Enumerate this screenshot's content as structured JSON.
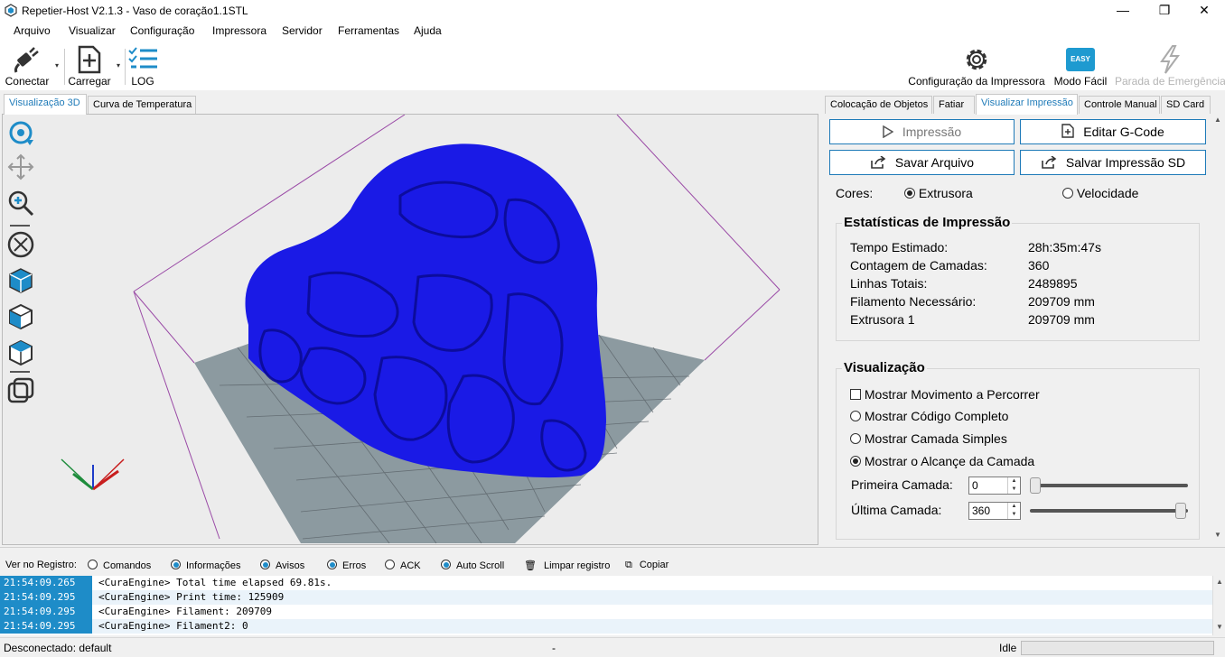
{
  "window": {
    "title": "Repetier-Host V2.1.3 - Vaso de coração1.1STL",
    "controls": {
      "minimize": "—",
      "maximize": "❐",
      "close": "✕"
    }
  },
  "menu": [
    "Arquivo",
    "Visualizar",
    "Configuração",
    "Impressora",
    "Servidor",
    "Ferramentas",
    "Ajuda"
  ],
  "toolbar": {
    "connect_label": "Conectar",
    "load_label": "Carregar",
    "log_label": "LOG",
    "printer_config_label": "Configuração da Impressora",
    "easy_mode_label": "Modo Fácil",
    "easy_badge": "EASY",
    "emergency_label": "Parada de Emergência"
  },
  "left_tabs": [
    "Visualização 3D",
    "Curva de Temperatura"
  ],
  "right_tabs": [
    "Colocação de Objetos",
    "Fatiar",
    "Visualizar Impressão",
    "Controle Manual",
    "SD Card"
  ],
  "preview": {
    "print_button": "Impressão",
    "edit_gcode_button": "Editar G-Code",
    "save_file_button": "Savar Arquivo",
    "save_sd_button": "Salvar Impressão SD",
    "colors_label": "Cores:",
    "color_extruder": "Extrusora",
    "color_speed": "Velocidade",
    "stats": {
      "title": "Estatísticas de Impressão",
      "rows": [
        {
          "label": "Tempo Estimado:",
          "value": "28h:35m:47s"
        },
        {
          "label": "Contagem de Camadas:",
          "value": "360"
        },
        {
          "label": "Linhas Totais:",
          "value": "2489895"
        },
        {
          "label": "Filamento Necessário:",
          "value": "209709 mm"
        },
        {
          "label": "Extrusora 1",
          "value": "209709 mm"
        }
      ]
    },
    "visual": {
      "title": "Visualização",
      "show_travel": "Mostrar Movimento a Percorrer",
      "show_complete": "Mostrar Código Completo",
      "show_single": "Mostrar Camada Simples",
      "show_range": "Mostrar o Alcançe da Camada",
      "first_layer_label": "Primeira Camada:",
      "first_layer_value": "0",
      "last_layer_label": "Última Camada:",
      "last_layer_value": "360",
      "first_slider_fraction": 0,
      "last_slider_fraction": 1
    }
  },
  "log": {
    "filter_label": "Ver no Registro:",
    "filters": [
      "Comandos",
      "Informações",
      "Avisos",
      "Erros",
      "ACK",
      "Auto Scroll"
    ],
    "clear_label": "Limpar registro",
    "copy_label": "Copiar",
    "rows": [
      {
        "time": "21:54:09.265",
        "msg": "<CuraEngine> Total time elapsed 69.81s."
      },
      {
        "time": "21:54:09.295",
        "msg": "<CuraEngine> Print time: 125909"
      },
      {
        "time": "21:54:09.295",
        "msg": "<CuraEngine> Filament: 209709"
      },
      {
        "time": "21:54:09.295",
        "msg": "<CuraEngine> Filament2: 0"
      }
    ]
  },
  "status": {
    "connection": "Desconectado: default",
    "middle": "-",
    "state": "Idle"
  },
  "colors": {
    "accent": "#1e8cc8",
    "model": "#1a1ae6",
    "bed": "#8c9aa0"
  }
}
